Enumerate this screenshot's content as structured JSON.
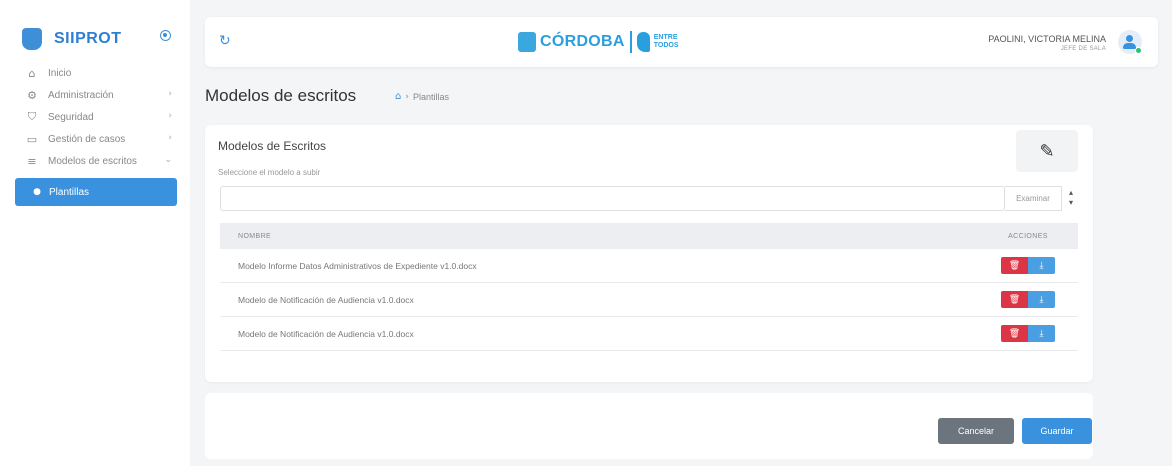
{
  "sidebar": {
    "brand": "SIIPROT",
    "items": [
      {
        "icon": "home-icon",
        "glyph": "⌂",
        "label": "Inicio",
        "caret": ""
      },
      {
        "icon": "gear-icon",
        "glyph": "⚙",
        "label": "Administración",
        "caret": "›"
      },
      {
        "icon": "shield-icon",
        "glyph": "⛉",
        "label": "Seguridad",
        "caret": "›"
      },
      {
        "icon": "folder-icon",
        "glyph": "▭",
        "label": "Gestión de casos",
        "caret": "›"
      },
      {
        "icon": "list-icon",
        "glyph": "≡",
        "label": "Modelos de escritos",
        "caret": "⌄"
      }
    ],
    "sub_item": {
      "icon": "bullet-icon",
      "glyph": "●",
      "label": "Plantillas"
    }
  },
  "header": {
    "refresh_glyph": "↻",
    "gov_name": "CÓRDOBA",
    "gov_slogan": "ENTRE TODOS",
    "user_name": "PAOLINI, VICTORIA MELINA",
    "user_role": "JEFE DE SALA"
  },
  "page": {
    "title": "Modelos de escritos",
    "breadcrumb_home": "⌂",
    "breadcrumb_sep": "›",
    "breadcrumb_current": "Plantillas"
  },
  "card": {
    "title": "Modelos de Escritos",
    "subtitle": "Seleccione el modelo a subir",
    "edit_glyph": "✎",
    "browse_label": "Examinar",
    "spinner_up": "▴",
    "spinner_down": "▾",
    "table": {
      "headers": {
        "name": "NOMBRE",
        "actions": "ACCIONES"
      },
      "rows": [
        {
          "name": "Modelo Informe Datos Administrativos de Expediente v1.0.docx"
        },
        {
          "name": "Modelo de Notificación de Audiencia v1.0.docx"
        },
        {
          "name": "Modelo de Notificación de Audiencia v1.0.docx"
        }
      ],
      "delete_glyph": "🗑",
      "download_glyph": "⤓"
    }
  },
  "footer": {
    "cancel_label": "Cancelar",
    "save_label": "Guardar"
  },
  "colors": {
    "accent": "#3a92de",
    "danger": "#dc3545",
    "secondary": "#6c757d"
  }
}
